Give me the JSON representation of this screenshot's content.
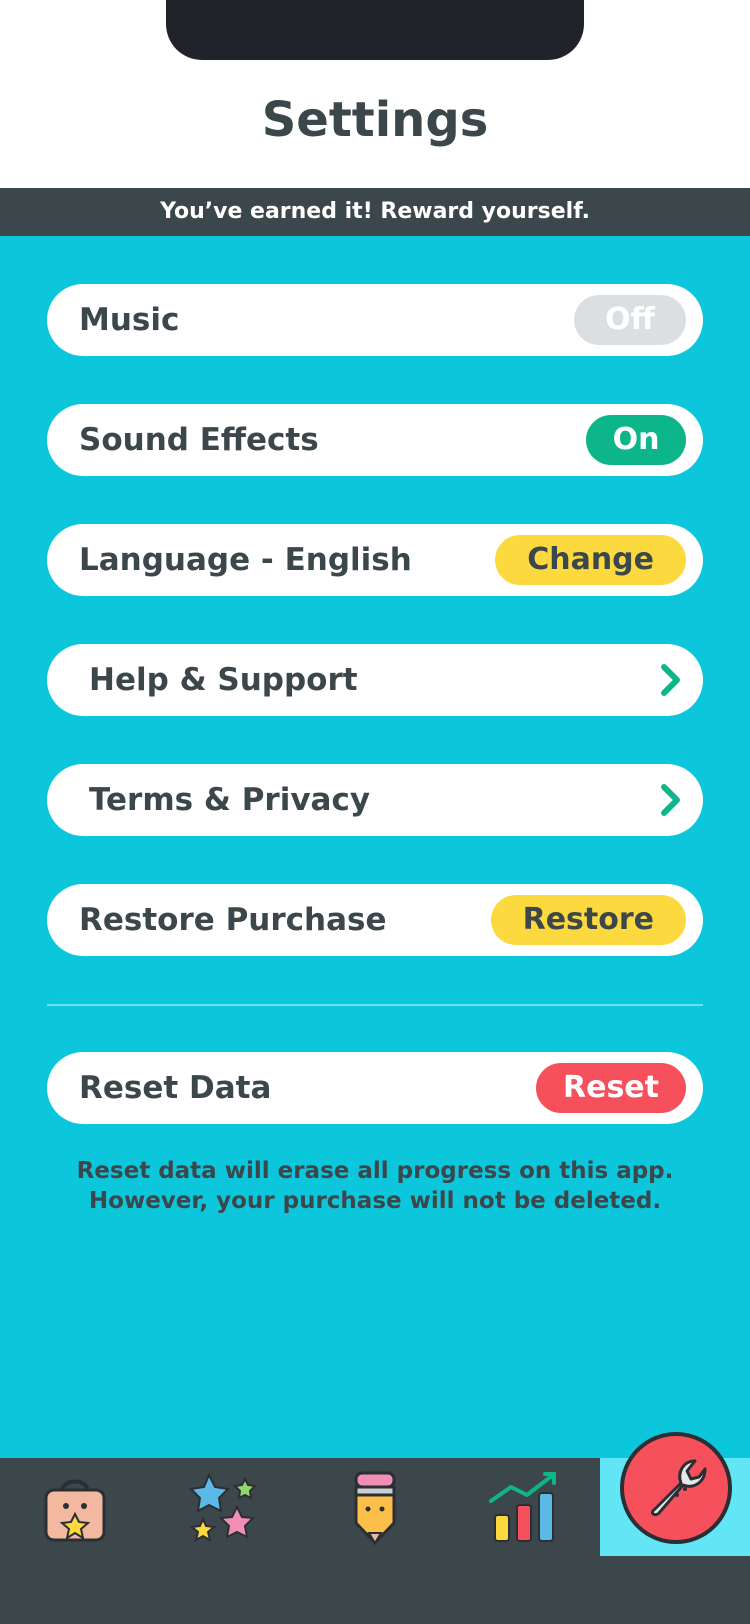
{
  "header": {
    "title": "Settings"
  },
  "banner": {
    "text": "You’ve earned it! Reward yourself."
  },
  "settings": {
    "music": {
      "label": "Music",
      "toggle": "Off"
    },
    "sound_effects": {
      "label": "Sound Effects",
      "toggle": "On"
    },
    "language": {
      "label": "Language - English",
      "button": "Change"
    },
    "help": {
      "label": "Help & Support"
    },
    "terms": {
      "label": "Terms & Privacy"
    },
    "restore": {
      "label": "Restore Purchase",
      "button": "Restore"
    },
    "reset": {
      "label": "Reset Data",
      "button": "Reset"
    }
  },
  "reset_note": {
    "line1": "Reset data will erase all progress on this app.",
    "line2": "However, your purchase will not be deleted."
  },
  "tabbar": {
    "tabs": [
      "shop-bag-icon",
      "stars-icon",
      "pencil-icon",
      "chart-icon",
      "wrench-icon"
    ],
    "active": "settings"
  },
  "colors": {
    "background": "#0cc6db",
    "header_dark": "#3c474b",
    "toggle_on": "#0db68a",
    "toggle_off": "#dcdfe1",
    "yellow_button": "#fcd93e",
    "red_button": "#f5505b",
    "chevron": "#0db68a"
  }
}
